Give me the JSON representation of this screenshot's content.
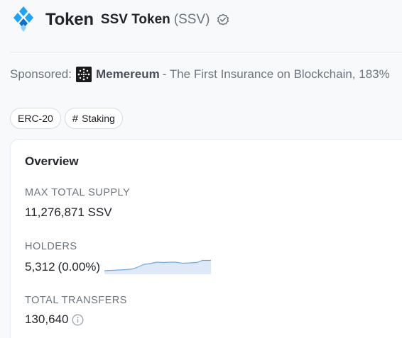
{
  "header": {
    "page_title": "Token",
    "token_name": "SSV Token",
    "token_symbol": "(SSV)"
  },
  "sponsored": {
    "label": "Sponsored:",
    "name": "Memereum",
    "text": " - The First Insurance on Blockchain, 183%"
  },
  "tags": [
    {
      "label": "ERC-20"
    },
    {
      "label": "Staking",
      "icon": "hash-icon"
    }
  ],
  "overview": {
    "title": "Overview",
    "max_supply_label": "MAX TOTAL SUPPLY",
    "max_supply_value": "11,276,871 SSV",
    "holders_label": "HOLDERS",
    "holders_value": "5,312",
    "holders_change": "(0.00%)",
    "transfers_label": "TOTAL TRANSFERS",
    "transfers_value": "130,640"
  },
  "colors": {
    "brand": "#1ba5f8",
    "sparkline": "#6fa8dc",
    "sparkline_fill": "#dde9f7"
  }
}
